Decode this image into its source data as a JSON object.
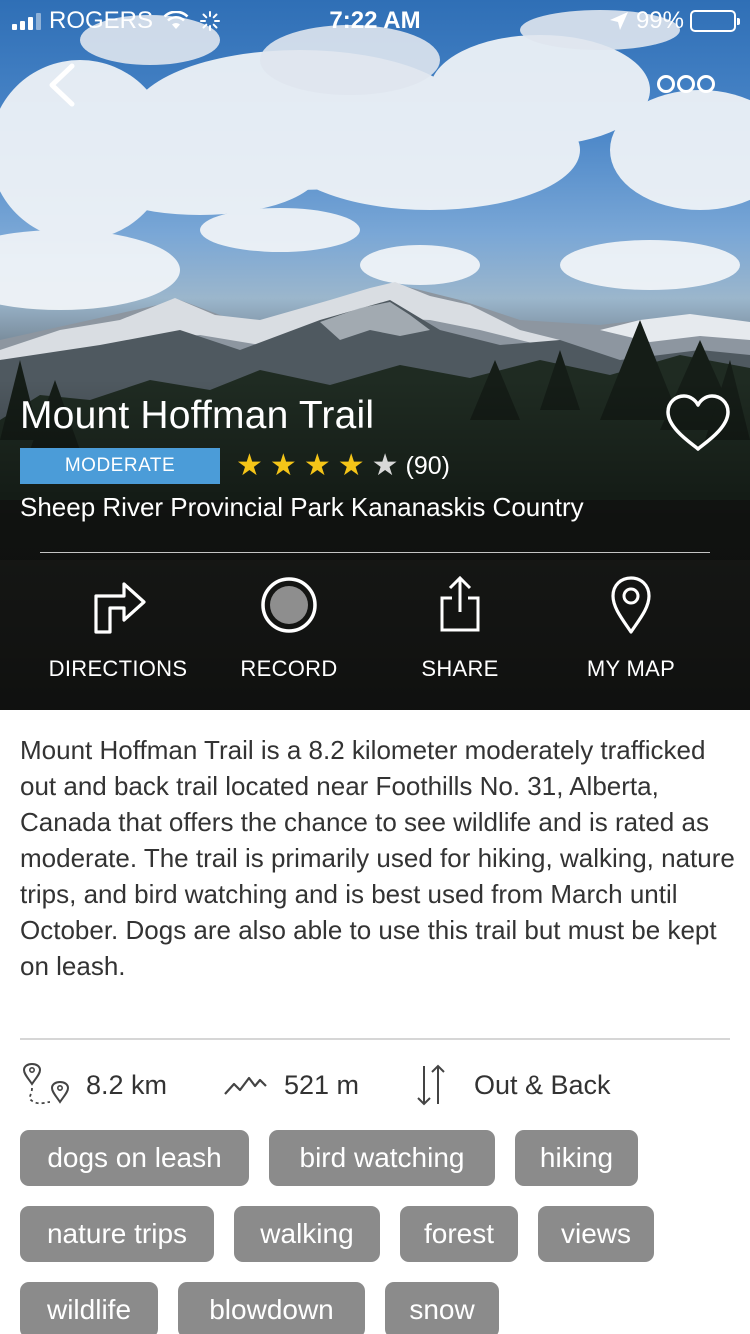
{
  "status_bar": {
    "carrier": "ROGERS",
    "time": "7:22 AM",
    "battery": "99%"
  },
  "trail": {
    "name": "Mount Hoffman Trail",
    "difficulty": "MODERATE",
    "rating": 4,
    "rating_max": 5,
    "review_count": "(90)",
    "location": "Sheep River Provincial Park Kananaskis Country"
  },
  "actions": [
    {
      "label": "DIRECTIONS",
      "icon": "directions-icon"
    },
    {
      "label": "RECORD",
      "icon": "record-icon"
    },
    {
      "label": "SHARE",
      "icon": "share-icon"
    },
    {
      "label": "MY MAP",
      "icon": "map-pin-icon"
    }
  ],
  "description": "Mount Hoffman Trail is a 8.2 kilometer moderately trafficked out and back trail located near Foothills No. 31, Alberta, Canada that offers the chance to see wildlife and is rated as moderate. The trail is primarily used for hiking, walking, nature trips, and bird watching and is best used from March until October. Dogs are also able to use this trail but must be kept on leash.",
  "stats": {
    "distance": "8.2 km",
    "elevation": "521 m",
    "route_type": "Out & Back"
  },
  "tags": [
    [
      "dogs on leash",
      "bird watching",
      "hiking"
    ],
    [
      "nature trips",
      "walking",
      "forest",
      "views"
    ],
    [
      "wildlife",
      "blowdown",
      "snow"
    ]
  ],
  "colors": {
    "difficulty_badge": "#4b9cd8",
    "star_on": "#f5c518",
    "star_off": "#d8d8d8",
    "tag_bg": "#8b8b8b"
  }
}
